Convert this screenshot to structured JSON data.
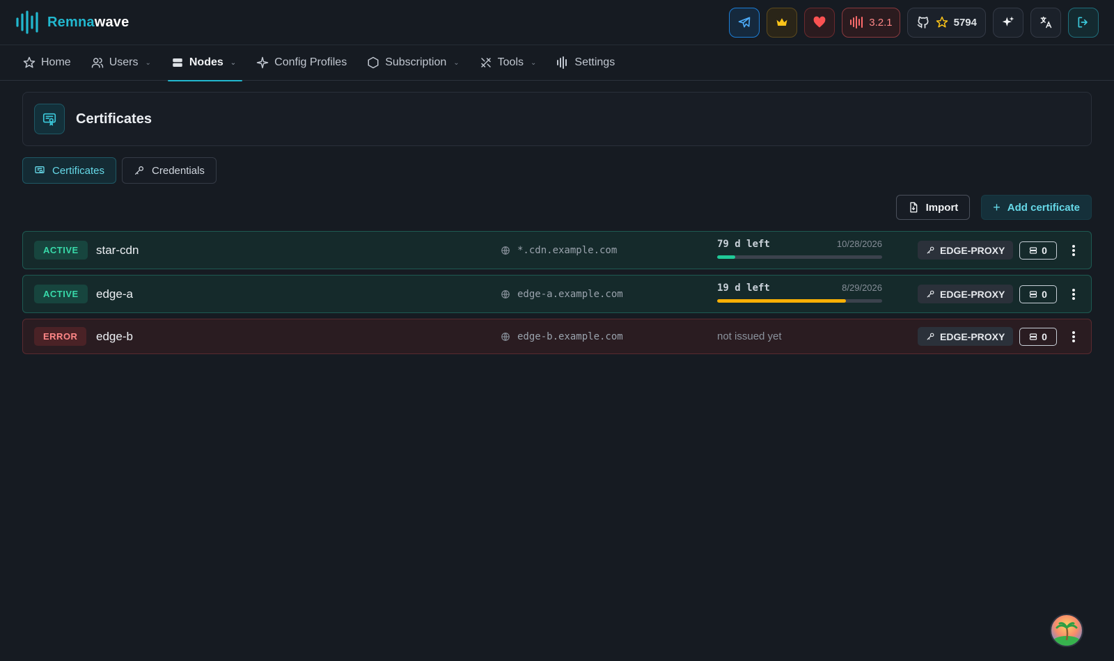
{
  "brand": {
    "name_part1": "Remna",
    "name_part2": "wave"
  },
  "header": {
    "version": "3.2.1",
    "github_stars": "5794"
  },
  "nav": {
    "home": "Home",
    "users": "Users",
    "nodes": "Nodes",
    "config_profiles": "Config Profiles",
    "subscription": "Subscription",
    "tools": "Tools",
    "settings": "Settings"
  },
  "page": {
    "title": "Certificates"
  },
  "tabs": {
    "certificates": "Certificates",
    "credentials": "Credentials"
  },
  "toolbar": {
    "import": "Import",
    "add": "Add certificate"
  },
  "certificates": [
    {
      "status": "ACTIVE",
      "name": "star-cdn",
      "domain": "*.cdn.example.com",
      "left": "79 d left",
      "date": "10/28/2026",
      "progress": 0.11,
      "bar_color": "#20c997",
      "tag": "EDGE-PROXY",
      "count": "0"
    },
    {
      "status": "ACTIVE",
      "name": "edge-a",
      "domain": "edge-a.example.com",
      "left": "19 d left",
      "date": "8/29/2026",
      "progress": 0.78,
      "bar_color": "#fab005",
      "tag": "EDGE-PROXY",
      "count": "0"
    },
    {
      "status": "ERROR",
      "name": "edge-b",
      "domain": "edge-b.example.com",
      "not_issued": "not issued yet",
      "tag": "EDGE-PROXY",
      "count": "0"
    }
  ]
}
